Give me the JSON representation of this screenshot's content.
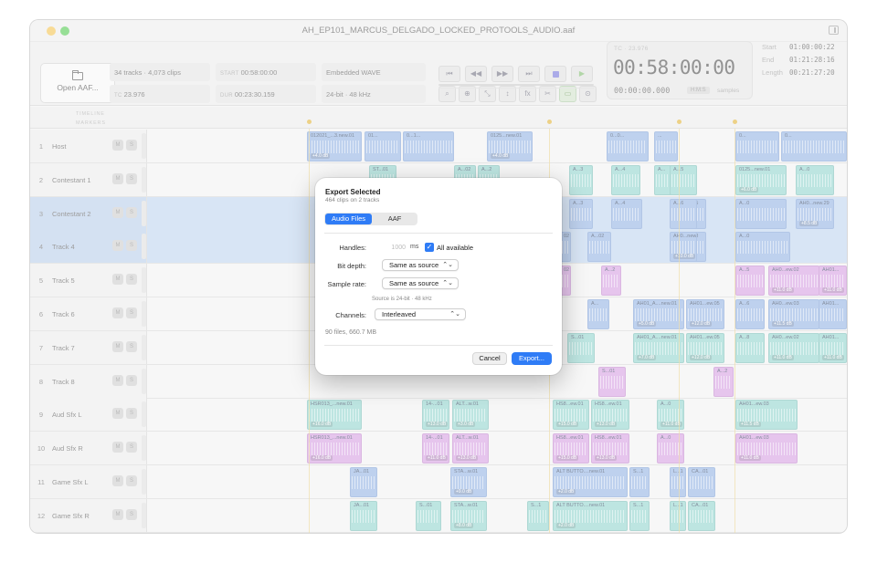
{
  "window": {
    "title": "AH_EP101_MARCUS_DELGADO_LOCKED_PROTOOLS_AUDIO.aaf"
  },
  "toolbar": {
    "open_label": "Open AAF...",
    "info": {
      "counts": "34 tracks · 4,073 clips",
      "start_label": "START",
      "start_value": "00:58:00:00",
      "format": "Embedded WAVE",
      "tc_label": "TC",
      "tc_value": "23.976",
      "dur_label": "DUR",
      "dur_value": "00:23:30.159",
      "bitrate": "24-bit · 48 kHz"
    },
    "transport_icons": [
      "skip-to-start-icon",
      "rewind-icon",
      "fast-forward-icon",
      "skip-to-end-icon",
      "stop-icon",
      "play-icon"
    ],
    "transport_glyphs": [
      "⏮",
      "◀◀",
      "▶▶",
      "⏭",
      "",
      "▶"
    ],
    "tool_icons": [
      "magnify-icon",
      "zoom-in-icon",
      "fit-icon",
      "stretch-vertical-icon",
      "fx-icon",
      "cut-icon",
      "monitor-icon",
      "crosshair-icon"
    ],
    "tool_glyphs": [
      "⌕",
      "⊕",
      "⤡",
      "↕",
      "fx",
      "✂",
      "▭",
      "⊙"
    ]
  },
  "timecode": {
    "top_label": "TC · 23.976",
    "main": "00:58:00:00",
    "sub": "00:00:00.000",
    "badge": "H:M:S",
    "unit": "samples"
  },
  "selection": {
    "start_label": "Start",
    "start": "01:00:00:22",
    "end_label": "End",
    "end": "01:21:28:16",
    "length_label": "Length",
    "length": "00:21:27:20"
  },
  "ruler": {
    "timeline_label": "TIMELINE",
    "markers_label": "MARKERS"
  },
  "tracks": [
    {
      "num": "1",
      "name": "Host",
      "m": "M",
      "s": "S",
      "selected": false
    },
    {
      "num": "2",
      "name": "Contestant 1",
      "m": "M",
      "s": "S",
      "selected": false
    },
    {
      "num": "3",
      "name": "Contestant 2",
      "m": "M",
      "s": "S",
      "selected": true
    },
    {
      "num": "4",
      "name": "Track 4",
      "m": "M",
      "s": "S",
      "selected": true
    },
    {
      "num": "5",
      "name": "Track 5",
      "m": "M",
      "s": "S",
      "selected": false
    },
    {
      "num": "6",
      "name": "Track 6",
      "m": "M",
      "s": "S",
      "selected": false
    },
    {
      "num": "7",
      "name": "Track 7",
      "m": "M",
      "s": "S",
      "selected": false
    },
    {
      "num": "8",
      "name": "Track 8",
      "m": "M",
      "s": "S",
      "selected": false
    },
    {
      "num": "9",
      "name": "Aud Sfx L",
      "m": "M",
      "s": "S",
      "selected": false
    },
    {
      "num": "10",
      "name": "Aud Sfx R",
      "m": "M",
      "s": "S",
      "selected": false
    },
    {
      "num": "11",
      "name": "Game Sfx L",
      "m": "M",
      "s": "S",
      "selected": false
    },
    {
      "num": "12",
      "name": "Game Sfx R",
      "m": "M",
      "s": "S",
      "selected": false
    }
  ],
  "clips": [
    {
      "t": 0,
      "c": "blue",
      "name": "012021_...3.new.01",
      "gain": "+4.0 dB"
    },
    {
      "t": 0,
      "c": "blue",
      "name": "01...",
      "gain": ""
    },
    {
      "t": 0,
      "c": "blue",
      "name": "0...1...",
      "gain": ""
    },
    {
      "t": 0,
      "c": "blue",
      "name": "0125...new.01",
      "gain": "+4.0 dB"
    },
    {
      "t": 0,
      "c": "blue",
      "name": "0...0...",
      "gain": ""
    },
    {
      "t": 0,
      "c": "blue",
      "name": "...",
      "gain": ""
    },
    {
      "t": 0,
      "c": "blue",
      "name": "0...",
      "gain": ""
    },
    {
      "t": 0,
      "c": "blue",
      "name": "0...",
      "gain": ""
    },
    {
      "t": 1,
      "c": "teal",
      "name": "ST...01",
      "gain": ""
    },
    {
      "t": 1,
      "c": "teal",
      "name": "A...02",
      "gain": ""
    },
    {
      "t": 1,
      "c": "teal",
      "name": "A...2",
      "gain": ""
    },
    {
      "t": 1,
      "c": "teal",
      "name": "A...3",
      "gain": ""
    },
    {
      "t": 1,
      "c": "teal",
      "name": "A...4",
      "gain": ""
    },
    {
      "t": 1,
      "c": "teal",
      "name": "A...",
      "gain": ""
    },
    {
      "t": 1,
      "c": "teal",
      "name": "0125...new.01",
      "gain": "+6.0 dB"
    },
    {
      "t": 1,
      "c": "teal",
      "name": "A...0",
      "gain": ""
    },
    {
      "t": 1,
      "c": "teal",
      "name": "AH0...new.26",
      "gain": "+9.0 dB"
    },
    {
      "t": 1,
      "c": "teal",
      "name": "A...5",
      "gain": ""
    },
    {
      "t": 2,
      "c": "blue",
      "name": "A...3",
      "gain": ""
    },
    {
      "t": 2,
      "c": "blue",
      "name": "A...4",
      "gain": ""
    },
    {
      "t": 2,
      "c": "blue",
      "name": "A...5",
      "gain": ""
    },
    {
      "t": 2,
      "c": "blue",
      "name": "A...0",
      "gain": ""
    },
    {
      "t": 2,
      "c": "blue",
      "name": "AH0...new.29",
      "gain": "+8.5 dB"
    },
    {
      "t": 2,
      "c": "blue",
      "name": "A...6",
      "gain": ""
    },
    {
      "t": 3,
      "c": "blue",
      "name": "02",
      "gain": ""
    },
    {
      "t": 3,
      "c": "blue",
      "name": "A...02",
      "gain": ""
    },
    {
      "t": 3,
      "c": "blue",
      "name": "A...8",
      "gain": ""
    },
    {
      "t": 3,
      "c": "blue",
      "name": "A...0",
      "gain": ""
    },
    {
      "t": 3,
      "c": "blue",
      "name": "AH0...new.28",
      "gain": "+10.0 dB"
    },
    {
      "t": 4,
      "c": "purple",
      "name": "02",
      "gain": ""
    },
    {
      "t": 4,
      "c": "purple",
      "name": "A...2",
      "gain": ""
    },
    {
      "t": 4,
      "c": "purple",
      "name": "A...5",
      "gain": ""
    },
    {
      "t": 4,
      "c": "purple",
      "name": "AH0...ew.02",
      "gain": "+11.0 dB"
    },
    {
      "t": 4,
      "c": "purple",
      "name": "AH01...",
      "gain": "+11.0 dB"
    },
    {
      "t": 5,
      "c": "blue",
      "name": "A...",
      "gain": ""
    },
    {
      "t": 5,
      "c": "blue",
      "name": "AH01_A....new.01",
      "gain": "+5.0 dB"
    },
    {
      "t": 5,
      "c": "blue",
      "name": "AH01...ew.05",
      "gain": "+12.0 dB"
    },
    {
      "t": 5,
      "c": "blue",
      "name": "A...6",
      "gain": ""
    },
    {
      "t": 5,
      "c": "blue",
      "name": "AH0...ew.03",
      "gain": "+11.5 dB"
    },
    {
      "t": 5,
      "c": "blue",
      "name": "AH01...",
      "gain": ""
    },
    {
      "t": 6,
      "c": "teal",
      "name": "S...01",
      "gain": ""
    },
    {
      "t": 6,
      "c": "teal",
      "name": "AH01_A....new.01",
      "gain": "+7.0 dB"
    },
    {
      "t": 6,
      "c": "teal",
      "name": "AH01...ew.05",
      "gain": "+12.0 dB"
    },
    {
      "t": 6,
      "c": "teal",
      "name": "A...8",
      "gain": ""
    },
    {
      "t": 6,
      "c": "teal",
      "name": "AH0...ew.02",
      "gain": "+11.0 dB"
    },
    {
      "t": 6,
      "c": "teal",
      "name": "AH01...",
      "gain": "+11.0 dB"
    },
    {
      "t": 7,
      "c": "purple",
      "name": "S...01",
      "gain": ""
    },
    {
      "t": 7,
      "c": "purple",
      "name": "A...2",
      "gain": ""
    },
    {
      "t": 8,
      "c": "teal",
      "name": "HSR013_...new.01",
      "gain": "+16.0 dB"
    },
    {
      "t": 8,
      "c": "teal",
      "name": "14-...01",
      "gain": "+13.0 dB"
    },
    {
      "t": 8,
      "c": "teal",
      "name": "ALT...w.01",
      "gain": "+3.0 dB"
    },
    {
      "t": 8,
      "c": "teal",
      "name": "HS8...ew.01",
      "gain": "+15.0 dB"
    },
    {
      "t": 8,
      "c": "teal",
      "name": "HS8...ew.01",
      "gain": "+13.0 dB"
    },
    {
      "t": 8,
      "c": "teal",
      "name": "A...0",
      "gain": "+11.0 dB"
    },
    {
      "t": 8,
      "c": "teal",
      "name": "AH01...ew.03",
      "gain": "+11.5 dB"
    },
    {
      "t": 9,
      "c": "purple",
      "name": "HSR013_...new.01",
      "gain": "+16.0 dB"
    },
    {
      "t": 9,
      "c": "purple",
      "name": "14-...01",
      "gain": "+11.0 dB"
    },
    {
      "t": 9,
      "c": "purple",
      "name": "ALT...w.01",
      "gain": "+13.0 dB"
    },
    {
      "t": 9,
      "c": "purple",
      "name": "HS8...ew.01",
      "gain": "+15.0 dB"
    },
    {
      "t": 9,
      "c": "purple",
      "name": "HS8...ew.01",
      "gain": "+13.0 dB"
    },
    {
      "t": 9,
      "c": "purple",
      "name": "A...0",
      "gain": ""
    },
    {
      "t": 9,
      "c": "purple",
      "name": "AH01...ew.03",
      "gain": "+11.0 dB"
    },
    {
      "t": 10,
      "c": "blue",
      "name": "JA...01",
      "gain": ""
    },
    {
      "t": 10,
      "c": "blue",
      "name": "STA...w.01",
      "gain": "+9.0 dB"
    },
    {
      "t": 10,
      "c": "blue",
      "name": "ALT BUTTO....new.01",
      "gain": "+2.0 dB"
    },
    {
      "t": 10,
      "c": "blue",
      "name": "S...1",
      "gain": ""
    },
    {
      "t": 10,
      "c": "blue",
      "name": "L...1",
      "gain": ""
    },
    {
      "t": 10,
      "c": "blue",
      "name": "CA...01",
      "gain": ""
    },
    {
      "t": 11,
      "c": "teal",
      "name": "JA...01",
      "gain": ""
    },
    {
      "t": 11,
      "c": "teal",
      "name": "S...01",
      "gain": ""
    },
    {
      "t": 11,
      "c": "teal",
      "name": "STA...w.01",
      "gain": "+8.0 dB"
    },
    {
      "t": 11,
      "c": "teal",
      "name": "S...1",
      "gain": ""
    },
    {
      "t": 11,
      "c": "teal",
      "name": "ALT BUTTO....new.01",
      "gain": "+2.0 dB"
    },
    {
      "t": 11,
      "c": "teal",
      "name": "S...1",
      "gain": ""
    },
    {
      "t": 11,
      "c": "teal",
      "name": "L...1",
      "gain": ""
    },
    {
      "t": 11,
      "c": "teal",
      "name": "CA...01",
      "gain": ""
    }
  ],
  "dialog": {
    "title": "Export Selected",
    "subtitle": "464 clips on 2 tracks",
    "tab_audio": "Audio Files",
    "tab_aaf": "AAF",
    "handles_label": "Handles:",
    "handles_placeholder": "1000",
    "handles_unit": "ms",
    "all_available_label": "All available",
    "bit_depth_label": "Bit depth:",
    "bit_depth_value": "Same as source",
    "sample_rate_label": "Sample rate:",
    "sample_rate_value": "Same as source",
    "source_hint": "Source is 24-bit · 48 kHz",
    "channels_label": "Channels:",
    "channels_value": "Interleaved",
    "summary": "90 files, 660.7 MB",
    "cancel_label": "Cancel",
    "export_label": "Export..."
  }
}
